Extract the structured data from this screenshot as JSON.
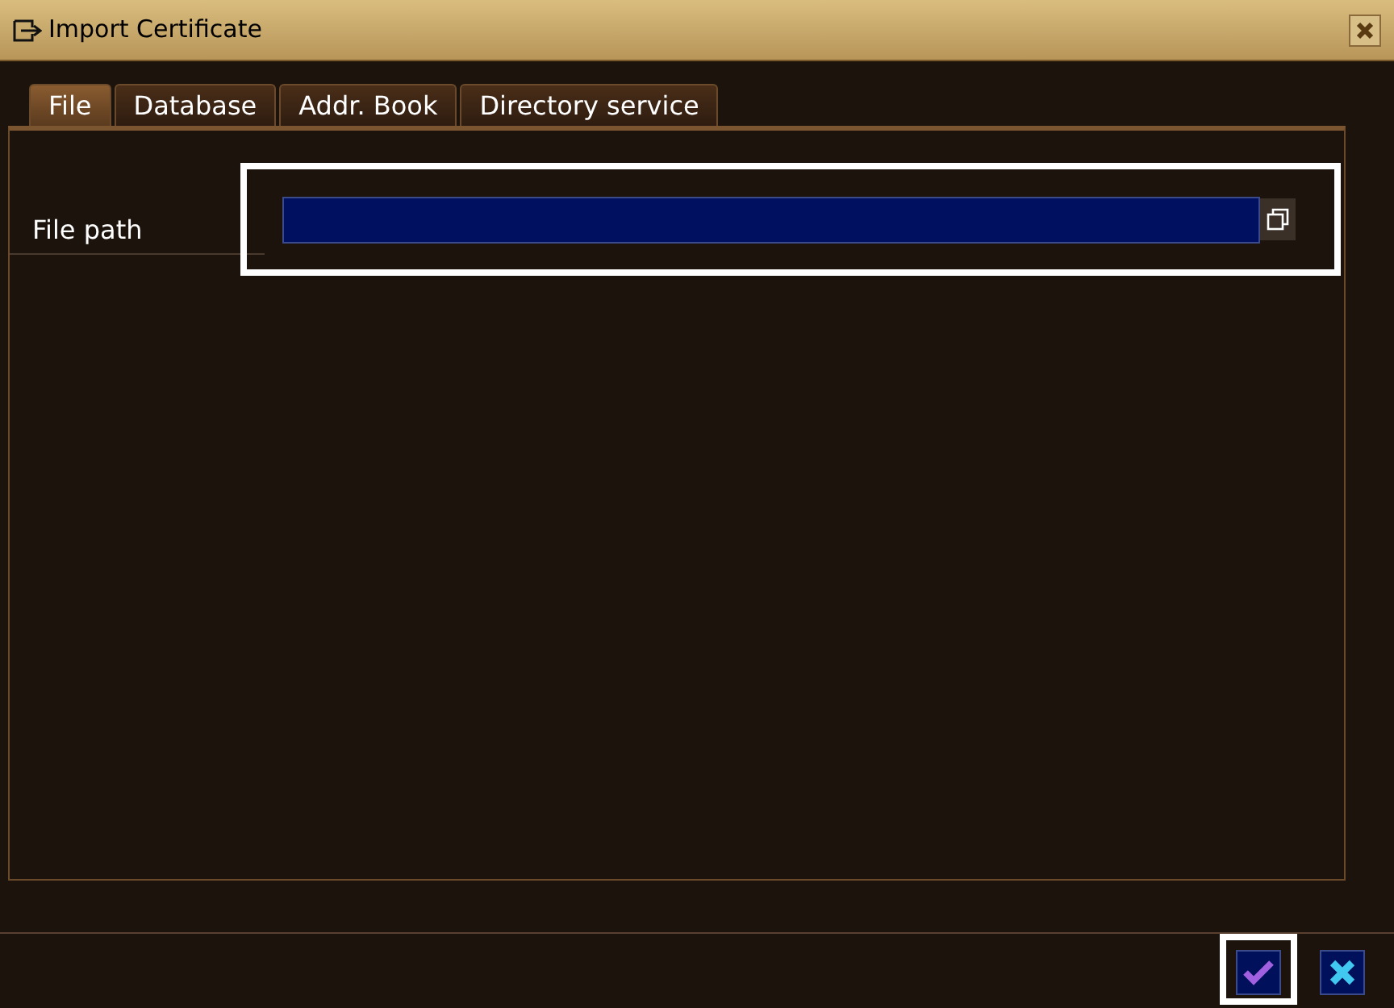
{
  "window": {
    "title": "Import Certificate"
  },
  "tabs": [
    {
      "label": "File",
      "selected": true
    },
    {
      "label": "Database",
      "selected": false
    },
    {
      "label": "Addr. Book",
      "selected": false
    },
    {
      "label": "Directory service",
      "selected": false
    }
  ],
  "fields": [
    {
      "label": "File path",
      "focused": true
    }
  ],
  "buttons": [
    {
      "kind": "confirm",
      "focused": true
    },
    {
      "kind": "cancel",
      "focused": false
    }
  ]
}
